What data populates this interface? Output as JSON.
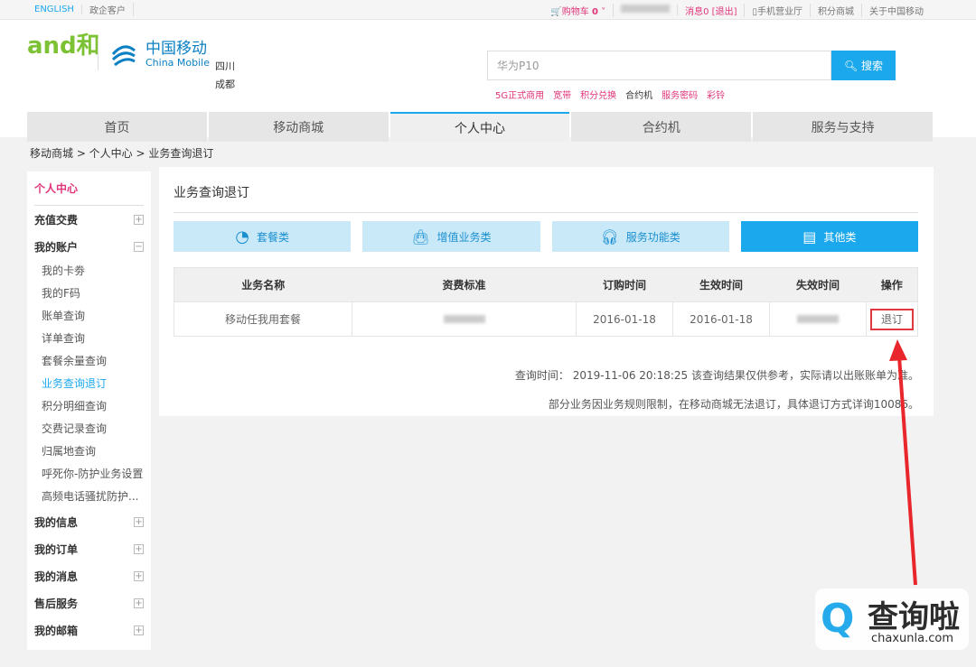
{
  "topbar": {
    "english": "ENGLISH",
    "enterprise": "政企客户",
    "cart": "购物车",
    "cart_count": "0",
    "messages": "消息0",
    "logout": "[退出]",
    "mobile_hall": "手机营业厅",
    "points_mall": "积分商城",
    "about": "关于中国移动"
  },
  "header": {
    "brand_and": "and和",
    "brand_cn": "中国移动",
    "brand_en": "China Mobile",
    "province": "四川",
    "city": "成都",
    "search_value": "华为P10",
    "search_button": "搜索",
    "hot_links": [
      "5G正式商用",
      "宽带",
      "积分兑换",
      "合约机",
      "服务密码",
      "彩铃"
    ]
  },
  "nav": [
    "首页",
    "移动商城",
    "个人中心",
    "合约机",
    "服务与支持"
  ],
  "breadcrumb": "移动商城 >  个人中心 >  业务查询退订",
  "sidebar": {
    "title": "个人中心",
    "groups": [
      {
        "label": "充值交费",
        "icon": "⊞"
      },
      {
        "label": "我的账户",
        "icon": "⊟"
      }
    ],
    "account_items": [
      "我的卡劵",
      "我的F码",
      "账单查询",
      "详单查询",
      "套餐余量查询",
      "业务查询退订",
      "积分明细查询",
      "交费记录查询",
      "归属地查询",
      "呼死你-防护业务设置",
      "高频电话骚扰防护..."
    ],
    "more_groups": [
      {
        "label": "我的信息",
        "icon": "⊞"
      },
      {
        "label": "我的订单",
        "icon": "⊞"
      },
      {
        "label": "我的消息",
        "icon": "⊞"
      },
      {
        "label": "售后服务",
        "icon": "⊞"
      },
      {
        "label": "我的邮箱",
        "icon": "⊞"
      }
    ]
  },
  "main": {
    "title": "业务查询退订",
    "categories": [
      "套餐类",
      "增值业务类",
      "服务功能类",
      "其他类"
    ],
    "table": {
      "headers": [
        "业务名称",
        "资费标准",
        "订购时间",
        "生效时间",
        "失效时间",
        "操作"
      ],
      "rows": [
        {
          "name": "移动任我用套餐",
          "start": "2016-01-18",
          "effective": "2016-01-18",
          "action": "退订"
        }
      ]
    },
    "note1": "查询时间：  2019-11-06 20:18:25 该查询结果仅供参考，实际请以出账账单为准。",
    "note2": "部分业务因业务规则限制，在移动商城无法退订，具体退订方式详询10086。"
  },
  "watermark": {
    "name": "查询啦",
    "url": "chaxunla.com"
  },
  "colors": {
    "accent": "#1ba8ec",
    "pink": "#e0357a",
    "red": "#e0383e"
  }
}
